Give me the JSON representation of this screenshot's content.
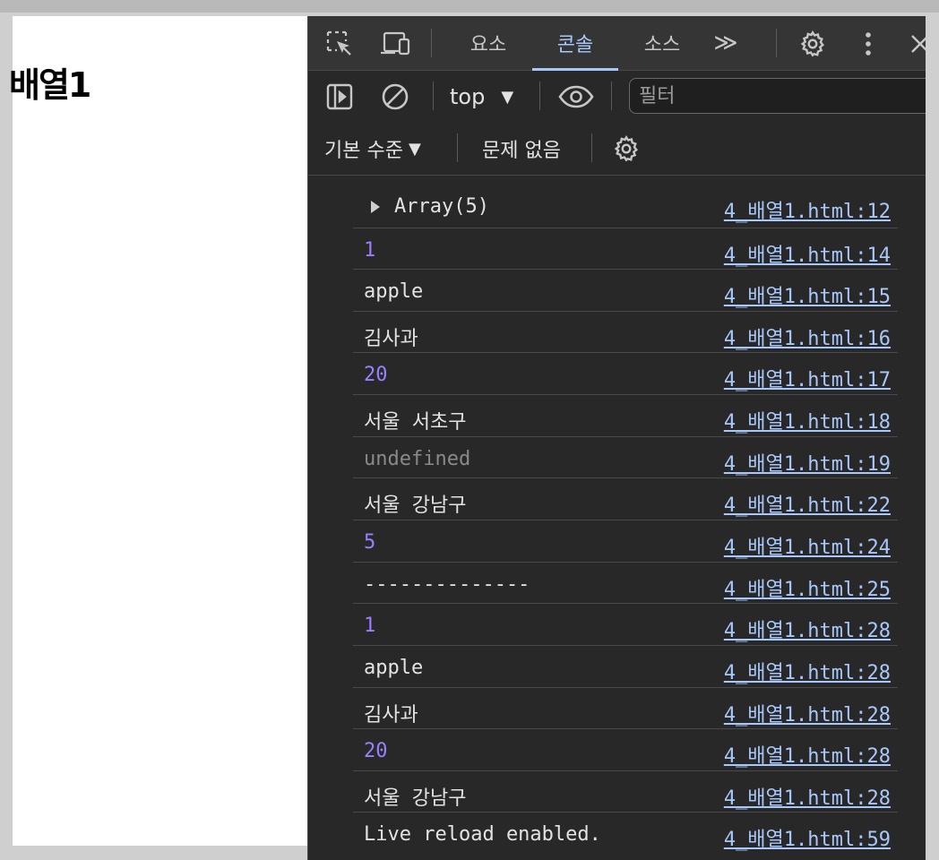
{
  "page": {
    "heading": "배열1"
  },
  "devtools": {
    "tabs": [
      {
        "label": "요소",
        "active": false
      },
      {
        "label": "콘솔",
        "active": true
      },
      {
        "label": "소스",
        "active": false
      }
    ],
    "more_tabs": "≫",
    "toolbar": {
      "context": "top",
      "filter_placeholder": "필터",
      "filter_value": ""
    },
    "toolbar2": {
      "levels": "기본 수준",
      "issues": "문제 없음"
    },
    "console_rows": [
      {
        "text": "Array(5)",
        "kind": "array",
        "source": "4_배열1.html:12"
      },
      {
        "text": "1",
        "kind": "number",
        "source": "4_배열1.html:14"
      },
      {
        "text": "apple",
        "kind": "string",
        "source": "4_배열1.html:15"
      },
      {
        "text": "김사과",
        "kind": "string",
        "source": "4_배열1.html:16"
      },
      {
        "text": "20",
        "kind": "number",
        "source": "4_배열1.html:17"
      },
      {
        "text": "서울 서초구",
        "kind": "string",
        "source": "4_배열1.html:18"
      },
      {
        "text": "undefined",
        "kind": "undefined",
        "source": "4_배열1.html:19"
      },
      {
        "text": "서울 강남구",
        "kind": "string",
        "source": "4_배열1.html:22"
      },
      {
        "text": "5",
        "kind": "number",
        "source": "4_배열1.html:24"
      },
      {
        "text": "--------------",
        "kind": "string",
        "source": "4_배열1.html:25"
      },
      {
        "text": "1",
        "kind": "number",
        "source": "4_배열1.html:28"
      },
      {
        "text": "apple",
        "kind": "string",
        "source": "4_배열1.html:28"
      },
      {
        "text": "김사과",
        "kind": "string",
        "source": "4_배열1.html:28"
      },
      {
        "text": "20",
        "kind": "number",
        "source": "4_배열1.html:28"
      },
      {
        "text": "서울 강남구",
        "kind": "string",
        "source": "4_배열1.html:28"
      },
      {
        "text": "Live reload enabled.",
        "kind": "string",
        "source": "4_배열1.html:59"
      }
    ],
    "colors": {
      "panel_bg": "#282828",
      "tab_bg": "#353535",
      "accent": "#a8c7fa",
      "number": "#9980ff",
      "undefined": "#8a8a8a"
    }
  }
}
